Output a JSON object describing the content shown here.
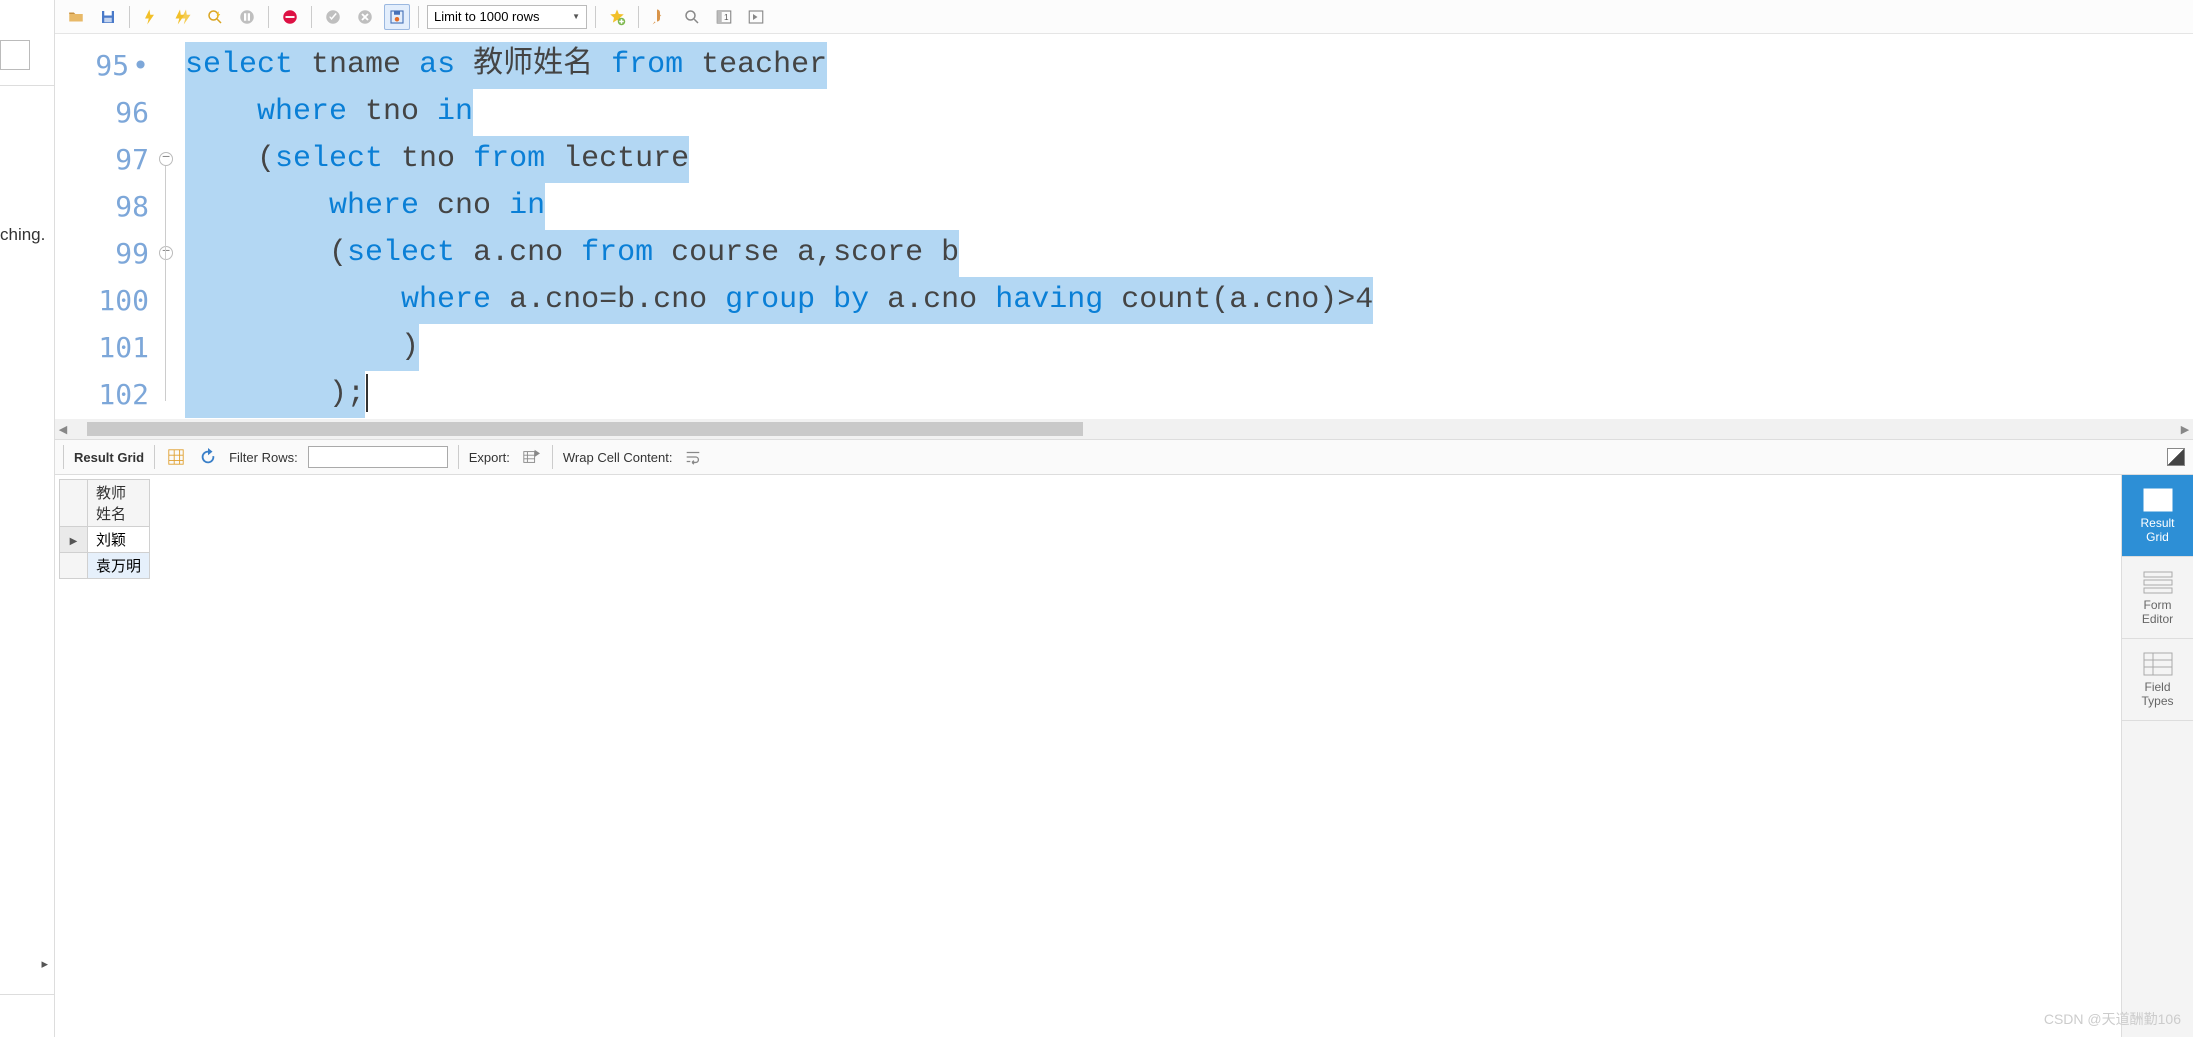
{
  "left_panel": {
    "text_fragment": "ching."
  },
  "toolbar": {
    "row_limit": "Limit to 1000 rows",
    "icons": {
      "open": "open-file-icon",
      "save": "save-icon",
      "run": "run-icon",
      "run_script": "run-script-icon",
      "explain": "explain-icon",
      "stop": "stop-icon",
      "cancel": "cancel-icon",
      "commit": "commit-icon",
      "rollback": "rollback-icon",
      "autocommit": "autocommit-icon",
      "favorite": "favorite-icon",
      "beautify": "beautify-icon",
      "search": "search-icon",
      "panel_left": "panel-left-icon",
      "panel_right": "panel-right-icon"
    }
  },
  "editor": {
    "lines": [
      {
        "num": "95",
        "modified": true,
        "tokens": [
          {
            "t": "select",
            "c": "kw"
          },
          {
            "t": " tname ",
            "c": "plain"
          },
          {
            "t": "as",
            "c": "kw"
          },
          {
            "t": " 教师姓名 ",
            "c": "plain"
          },
          {
            "t": "from",
            "c": "kw"
          },
          {
            "t": " teacher",
            "c": "plain"
          }
        ]
      },
      {
        "num": "96",
        "tokens": [
          {
            "t": "    ",
            "c": "plain"
          },
          {
            "t": "where",
            "c": "kw"
          },
          {
            "t": " tno ",
            "c": "plain"
          },
          {
            "t": "in",
            "c": "kw"
          }
        ]
      },
      {
        "num": "97",
        "fold": true,
        "tokens": [
          {
            "t": "    (",
            "c": "plain"
          },
          {
            "t": "select",
            "c": "kw"
          },
          {
            "t": " tno ",
            "c": "plain"
          },
          {
            "t": "from",
            "c": "kw"
          },
          {
            "t": " lecture",
            "c": "plain"
          }
        ]
      },
      {
        "num": "98",
        "tokens": [
          {
            "t": "        ",
            "c": "plain"
          },
          {
            "t": "where",
            "c": "kw"
          },
          {
            "t": " cno ",
            "c": "plain"
          },
          {
            "t": "in",
            "c": "kw"
          }
        ]
      },
      {
        "num": "99",
        "fold": true,
        "tokens": [
          {
            "t": "        (",
            "c": "plain"
          },
          {
            "t": "select",
            "c": "kw"
          },
          {
            "t": " a.cno ",
            "c": "plain"
          },
          {
            "t": "from",
            "c": "kw"
          },
          {
            "t": " course a,score b",
            "c": "plain"
          }
        ]
      },
      {
        "num": "100",
        "tokens": [
          {
            "t": "            ",
            "c": "plain"
          },
          {
            "t": "where",
            "c": "kw"
          },
          {
            "t": " a.cno=b.cno ",
            "c": "plain"
          },
          {
            "t": "group",
            "c": "kw"
          },
          {
            "t": " ",
            "c": "plain"
          },
          {
            "t": "by",
            "c": "kw"
          },
          {
            "t": " a.cno ",
            "c": "plain"
          },
          {
            "t": "having",
            "c": "kw"
          },
          {
            "t": " count(a.cno)>4",
            "c": "plain"
          }
        ]
      },
      {
        "num": "101",
        "tokens": [
          {
            "t": "            )",
            "c": "plain"
          }
        ]
      },
      {
        "num": "102",
        "cursor": true,
        "tokens": [
          {
            "t": "        );",
            "c": "plain"
          }
        ]
      }
    ]
  },
  "result_toolbar": {
    "title": "Result Grid",
    "filter_label": "Filter Rows:",
    "filter_value": "",
    "export_label": "Export:",
    "wrap_label": "Wrap Cell Content:"
  },
  "grid": {
    "header": "教师\n姓名",
    "rows": [
      {
        "active": true,
        "v": "刘颖"
      },
      {
        "active": false,
        "v": "袁万明",
        "sel": true
      }
    ]
  },
  "side_tabs": {
    "t0": "Result\nGrid",
    "t1": "Form\nEditor",
    "t2": "Field\nTypes"
  },
  "watermark": "CSDN @天道酬勤106"
}
